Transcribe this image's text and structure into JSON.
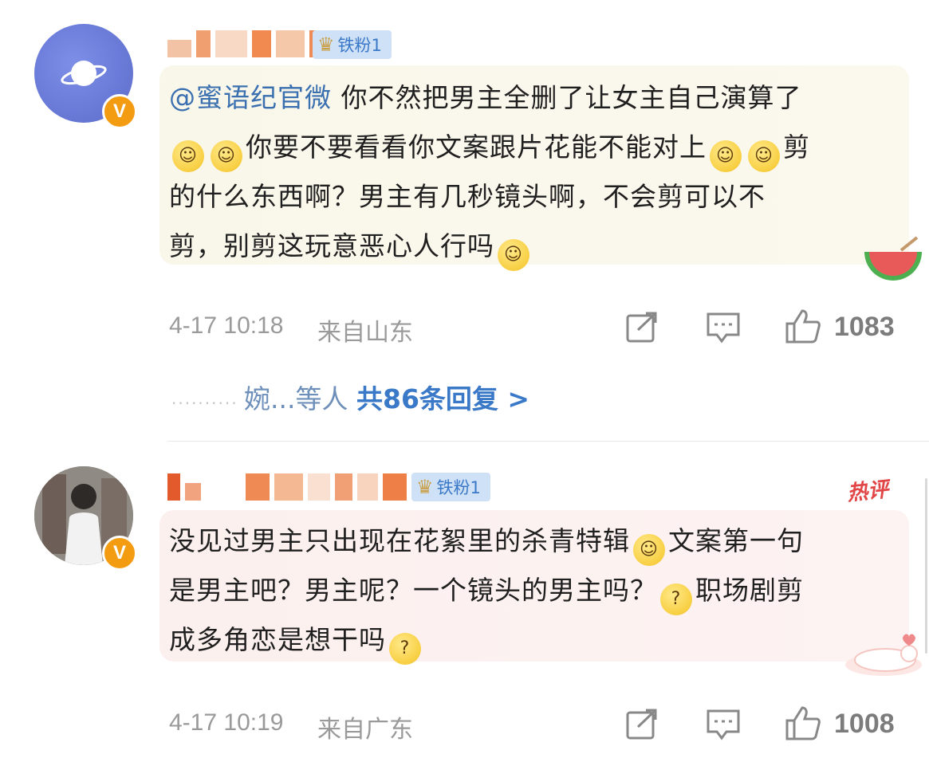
{
  "comments": [
    {
      "fan_label": "铁粉1",
      "text_segments": {
        "mention": "@蜜语纪官微",
        "t1": "你不然把男主全删了让女主自己演算了",
        "t2": "你要不要看看你文案跟片花能不能对上",
        "t3": "剪",
        "t4": "的什么东西啊？男主有几秒镜头啊，不会剪可以不",
        "t5": "剪，别剪这玩意恶心人行吗"
      },
      "time": "4-17 10:18",
      "location": "来自山东",
      "likes": "1083",
      "reply_names": "婉...等人",
      "reply_count": "共86条回复 >"
    },
    {
      "fan_label": "铁粉1",
      "hot_label": "热评",
      "text_segments": {
        "t1": "没见过男主只出现在花絮里的杀青特辑",
        "t2": "文案第一句",
        "t3": "是男主吧？男主呢？一个镜头的男主吗？",
        "t4": "职场剧剪",
        "t5": "成多角恋是想干吗"
      },
      "time": "4-17 10:19",
      "location": "来自广东",
      "likes": "1008"
    }
  ],
  "icons": {
    "share": "share-icon",
    "comment": "comment-icon",
    "like": "thumbs-up-icon",
    "emoji_smile": "smile-emoji-icon",
    "emoji_puzzled": "puzzled-emoji-icon"
  },
  "colors": {
    "mention": "#3a6fb0",
    "fan_badge": "#cfe1f7",
    "verified": "#f39c12",
    "hot": "#e24545"
  }
}
